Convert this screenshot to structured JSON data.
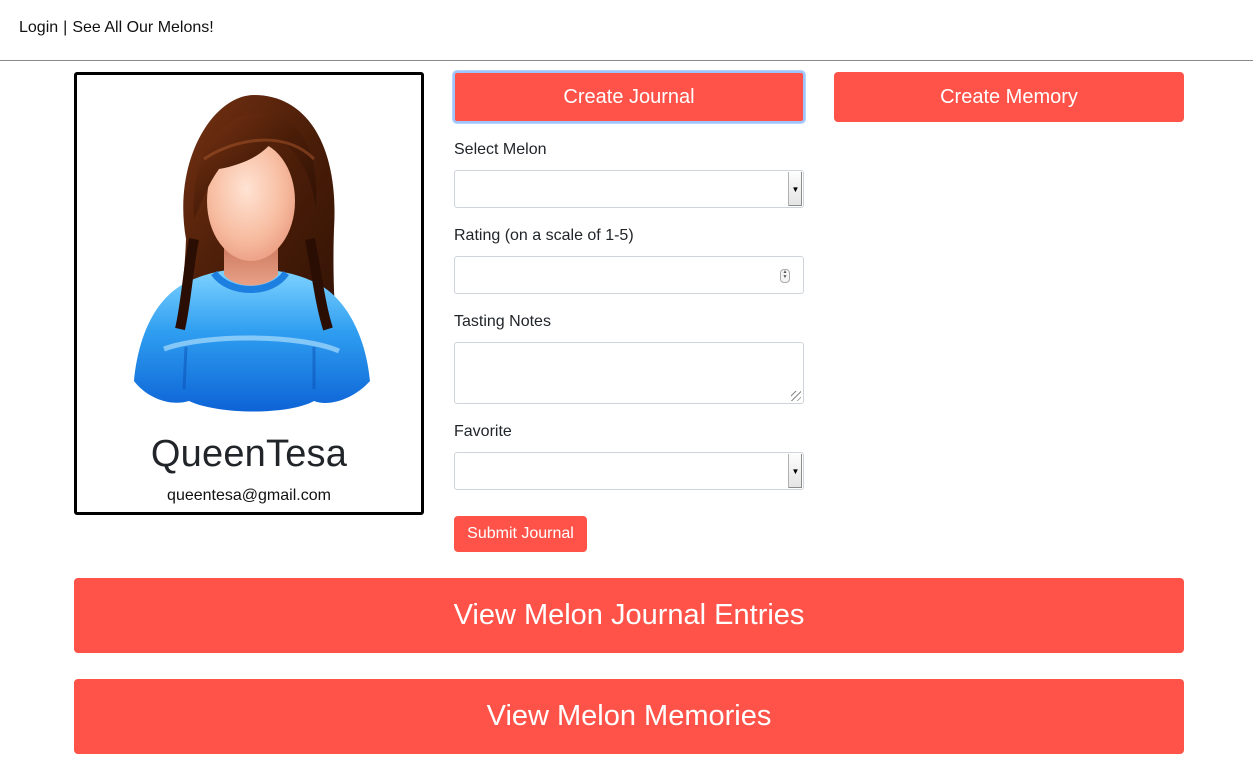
{
  "nav": {
    "login": "Login",
    "separator": "|",
    "melons_link": "See All Our Melons!"
  },
  "profile": {
    "avatar_icon": "female-user-avatar-icon",
    "username": "QueenTesa",
    "email": "queentesa@gmail.com"
  },
  "actions": {
    "create_journal": "Create Journal",
    "create_memory": "Create Memory"
  },
  "journal_form": {
    "select_melon_label": "Select Melon",
    "select_melon_value": "",
    "rating_label": "Rating (on a scale of 1-5)",
    "rating_value": "",
    "tasting_notes_label": "Tasting Notes",
    "tasting_notes_value": "",
    "favorite_label": "Favorite",
    "favorite_value": "",
    "submit": "Submit Journal"
  },
  "views": {
    "journal_entries": "View Melon Journal Entries",
    "memories": "View Melon Memories"
  },
  "colors": {
    "accent": "#ff5349",
    "focus_ring": "#9ec5fe",
    "card_border": "#000000"
  }
}
